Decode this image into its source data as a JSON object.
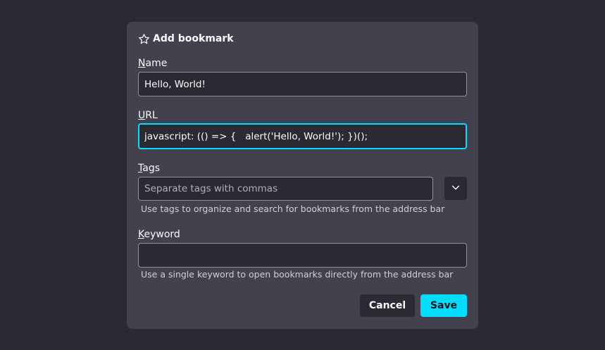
{
  "dialog": {
    "title": "Add bookmark",
    "title_icon": "star-icon"
  },
  "name_field": {
    "label_access": "N",
    "label_rest": "ame",
    "value": "Hello, World!"
  },
  "url_field": {
    "label_access": "U",
    "label_rest": "RL",
    "value": "javascript: (() => {   alert('Hello, World!'); })();"
  },
  "tags_field": {
    "label_access": "T",
    "label_rest": "ags",
    "placeholder": "Separate tags with commas",
    "help": "Use tags to organize and search for bookmarks from the address bar",
    "dropdown_icon": "chevron-down-icon"
  },
  "keyword_field": {
    "label_access": "K",
    "label_rest": "eyword",
    "value": "",
    "help": "Use a single keyword to open bookmarks directly from the address bar"
  },
  "buttons": {
    "cancel": "Cancel",
    "save": "Save"
  },
  "colors": {
    "background": "#2b2a33",
    "dialog": "#42414d",
    "accent": "#00ddff"
  }
}
